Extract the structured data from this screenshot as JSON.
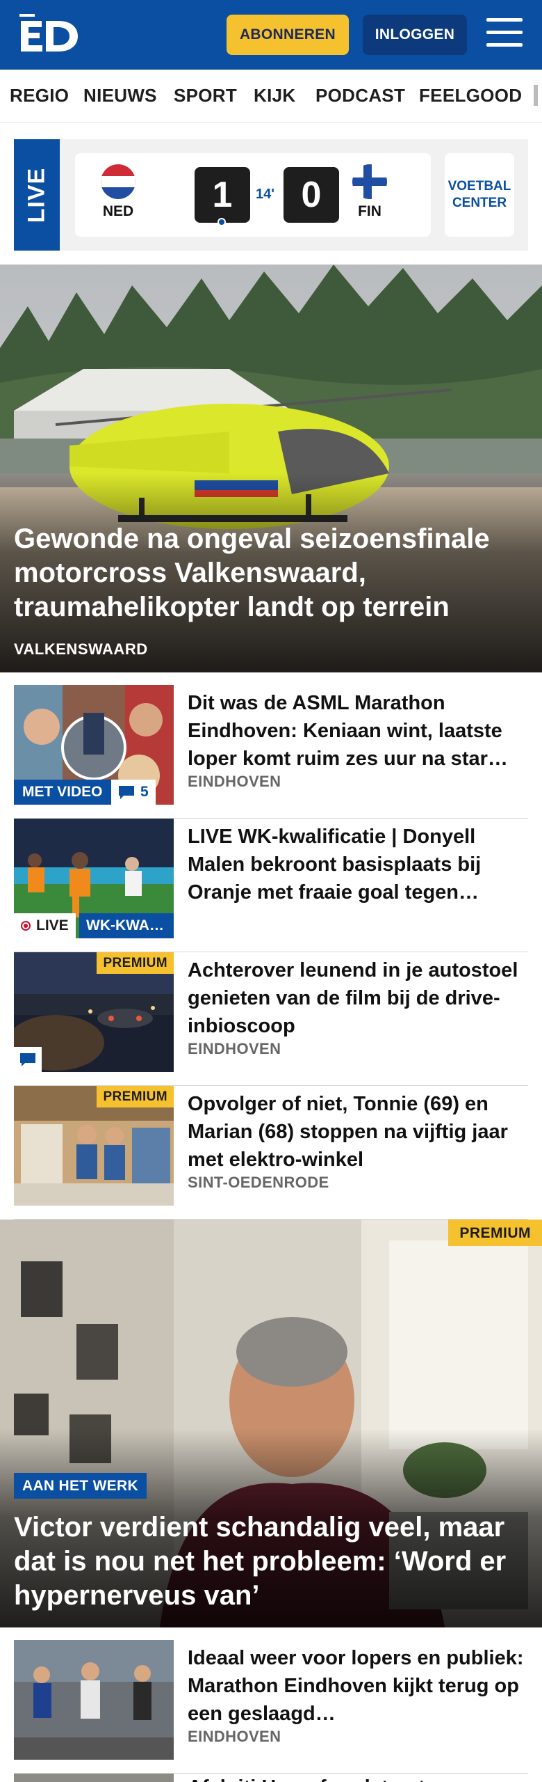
{
  "header": {
    "logo_text": "ED",
    "subscribe_label": "ABONNEREN",
    "login_label": "INLOGGEN",
    "brand_color": "#0a4fa1",
    "accent_color": "#f6c12f"
  },
  "nav": {
    "items": [
      "REGIO",
      "NIEUWS",
      "SPORT",
      "KIJK",
      "PODCAST",
      "FEELGOOD"
    ]
  },
  "live_widget": {
    "tab_label": "LIVE",
    "home": {
      "code": "NED",
      "score": "1"
    },
    "away": {
      "code": "FIN",
      "score": "0"
    },
    "minute": "14'",
    "center_label_1": "VOETBAL",
    "center_label_2": "CENTER"
  },
  "hero": {
    "title": "Gewonde na ongeval seizoensfinale motorcross Valkenswaard, traumahelikopter landt op terrein",
    "location": "VALKENSWAARD"
  },
  "articles": [
    {
      "title": "Dit was de ASML Marathon Eindhoven: Keniaan wint, laatste loper komt ruim zes uur na star…",
      "location": "EINDHOVEN",
      "video_label": "MET VIDEO",
      "comment_count": "5"
    },
    {
      "title": "LIVE WK-kwalificatie | Donyell Malen bekroont basisplaats bij Oranje met fraaie goal tegen…",
      "live_label": "LIVE",
      "tag_label": "WK-KWA…"
    },
    {
      "title": "Achterover leunend in je autostoel genieten van de film bij de drive-inbioscoop",
      "location": "EINDHOVEN",
      "premium_label": "PREMIUM"
    },
    {
      "title": "Opvolger of niet, Tonnie (69) en Marian (68) stoppen na vijftig jaar met elektro-winkel",
      "location": "SINT-OEDENRODE",
      "premium_label": "PREMIUM"
    }
  ],
  "feature": {
    "premium_label": "PREMIUM",
    "tag": "AAN HET WERK",
    "title": "Victor verdient schandalig veel, maar dat is nou net het probleem: ‘Word er hypernerveus van’"
  },
  "bottom_article": {
    "title": "Ideaal weer voor lopers en publiek: Marathon Eindhoven kijkt terug op een geslaagd…",
    "location": "EINDHOVEN",
    "partial_title": "Afsluiti Heezefrandstraat"
  }
}
